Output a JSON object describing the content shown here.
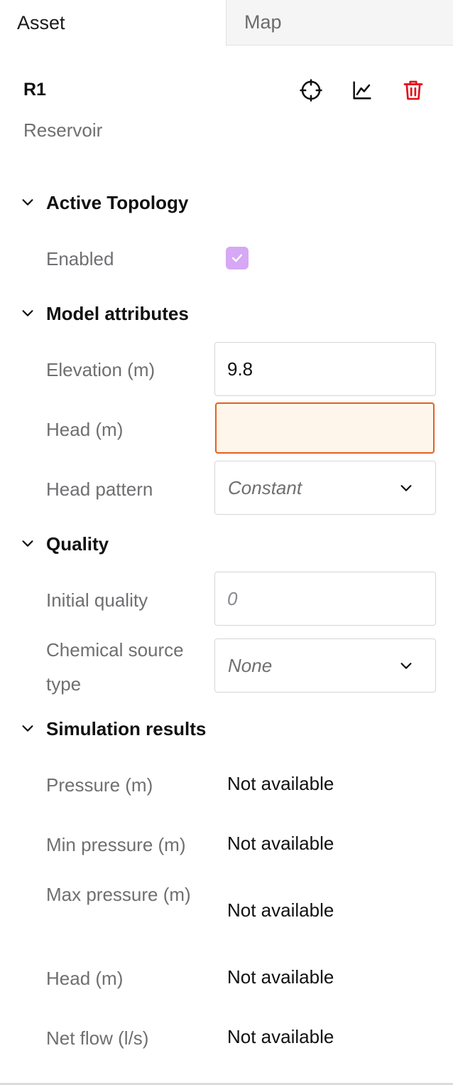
{
  "tabs": [
    {
      "label": "Asset",
      "active": true
    },
    {
      "label": "Map",
      "active": false
    }
  ],
  "asset": {
    "id": "R1",
    "type": "Reservoir",
    "actions": {
      "locate_icon": "crosshair-icon",
      "chart_icon": "line-chart-icon",
      "delete_icon": "trash-icon",
      "delete_color": "#e0121a"
    }
  },
  "sections": {
    "topology": {
      "title": "Active Topology",
      "enabled_label": "Enabled",
      "enabled": true,
      "checkbox_color": "#d6a8f5"
    },
    "model": {
      "title": "Model attributes",
      "elevation_label": "Elevation (m)",
      "elevation_value": "9.8",
      "head_label": "Head (m)",
      "head_value": "",
      "head_pattern_label": "Head pattern",
      "head_pattern_value": "Constant",
      "error_color": "#e2621b"
    },
    "quality": {
      "title": "Quality",
      "initial_label": "Initial quality",
      "initial_placeholder": "0",
      "source_type_label": "Chemical source type",
      "source_type_value": "None"
    },
    "results": {
      "title": "Simulation results",
      "rows": [
        {
          "label": "Pressure (m)",
          "value": "Not available"
        },
        {
          "label": "Min pressure (m)",
          "value": "Not available"
        },
        {
          "label": "Max pressure (m)",
          "value": "Not available"
        },
        {
          "label": "Head (m)",
          "value": "Not available"
        },
        {
          "label": "Net flow (l/s)",
          "value": "Not available"
        }
      ]
    }
  }
}
